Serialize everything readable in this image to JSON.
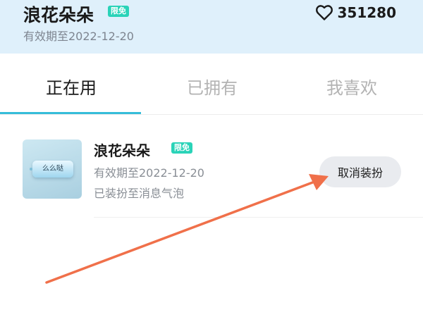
{
  "header": {
    "title": "浪花朵朵",
    "badge": "限免",
    "validity": "有效期至2022-12-20",
    "likes_icon": "heart-icon",
    "likes_count": "351280"
  },
  "tabs": [
    {
      "label": "正在用",
      "active": true
    },
    {
      "label": "已拥有",
      "active": false
    },
    {
      "label": "我喜欢",
      "active": false
    }
  ],
  "item": {
    "preview_text": "么么哒",
    "title": "浪花朵朵",
    "badge": "限免",
    "validity": "有效期至2022-12-20",
    "status": "已装扮至消息气泡",
    "button_label": "取消装扮"
  },
  "colors": {
    "header_bg": "#dff0fb",
    "badge": "#2ad3b8",
    "tab_indicator": "#35bdd9",
    "annotation_arrow": "#f0704a"
  }
}
